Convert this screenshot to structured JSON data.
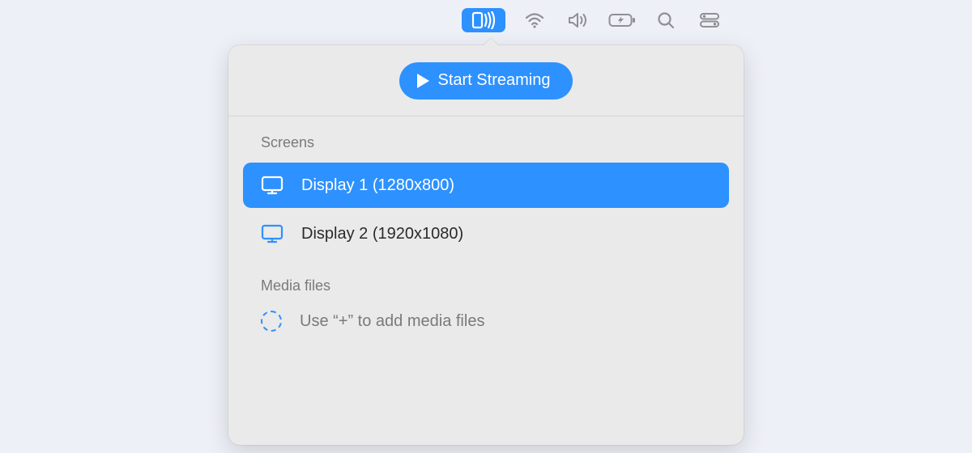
{
  "menubar": {
    "icons": [
      "cast",
      "wifi",
      "volume",
      "battery",
      "search",
      "control-center"
    ],
    "active_index": 0
  },
  "popover": {
    "start_button_label": "Start Streaming",
    "sections": {
      "screens": {
        "label": "Screens",
        "items": [
          {
            "label": "Display 1 (1280x800)",
            "selected": true
          },
          {
            "label": "Display 2 (1920x1080)",
            "selected": false
          }
        ]
      },
      "media": {
        "label": "Media files",
        "placeholder": "Use “+” to add media files"
      }
    }
  },
  "colors": {
    "accent": "#2d91ff",
    "panel_bg": "#eaeaea",
    "page_bg": "#eef0f7",
    "muted_text": "#7a7a7e"
  }
}
